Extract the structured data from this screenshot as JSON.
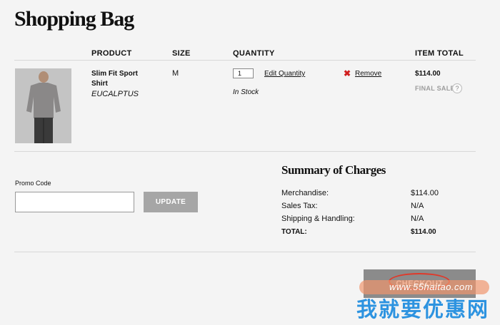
{
  "page": {
    "title": "Shopping Bag"
  },
  "table": {
    "headers": {
      "product": "PRODUCT",
      "size": "SIZE",
      "quantity": "QUANTITY",
      "item_total": "ITEM TOTAL"
    }
  },
  "item": {
    "name": "Slim Fit Sport Shirt",
    "color": "EUCALPTUS",
    "size": "M",
    "quantity": "1",
    "edit_quantity": "Edit Quantity",
    "stock": "In Stock",
    "remove": "Remove",
    "total": "$114.00",
    "final_sale": "FINAL SALE",
    "help": "?"
  },
  "promo": {
    "label": "Promo Code",
    "value": "",
    "update_label": "UPDATE"
  },
  "summary": {
    "title": "Summary of Charges",
    "rows": [
      {
        "label": "Merchandise:",
        "value": "$114.00"
      },
      {
        "label": "Sales Tax:",
        "value": "N/A"
      },
      {
        "label": "Shipping & Handling:",
        "value": "N/A"
      },
      {
        "label": "TOTAL:",
        "value": "$114.00"
      }
    ]
  },
  "checkout": {
    "label": "CHECKOUT"
  },
  "watermark": {
    "url": "www.55haitao.com",
    "text": "我就要优惠网"
  },
  "colors": {
    "remove_icon": "#d01f1f",
    "checkout_bg": "#8b8b8b",
    "update_bg": "#a6a6a6",
    "watermark_blue": "#2d93e0"
  }
}
